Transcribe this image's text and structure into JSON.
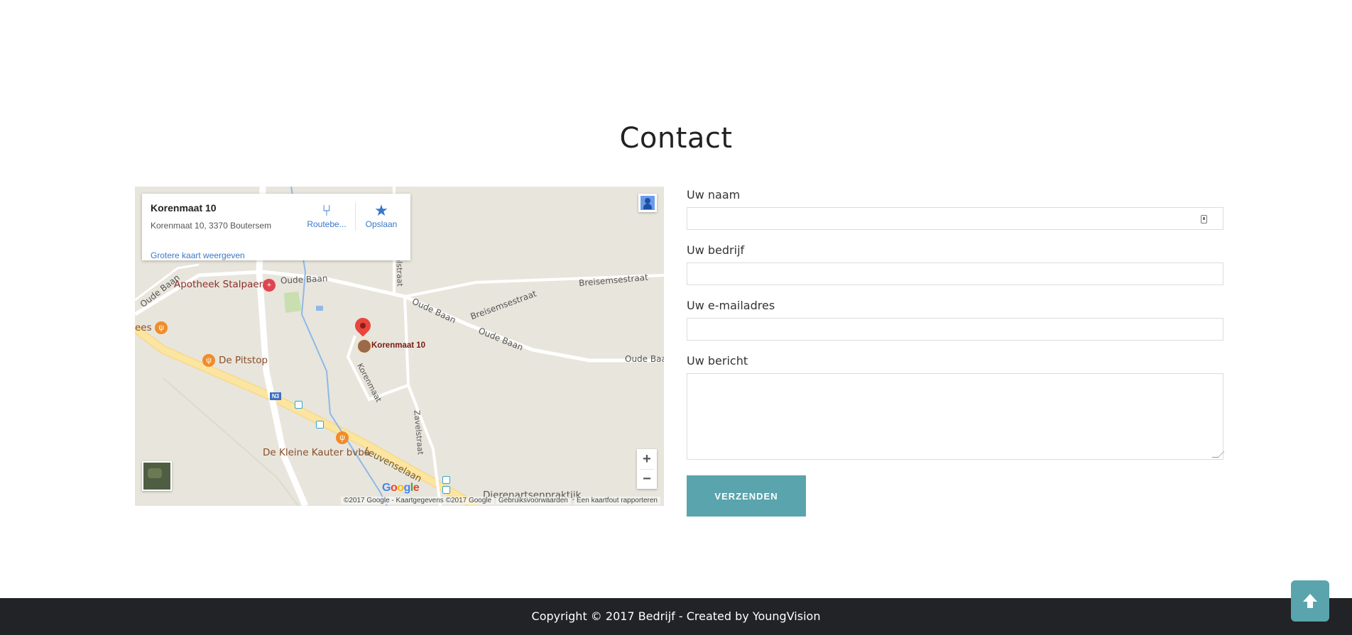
{
  "page": {
    "section_title": "Contact"
  },
  "map": {
    "info": {
      "place_name": "Korenmaat 10",
      "address": "Korenmaat 10, 3370 Boutersem",
      "larger_map_link": "Grotere kaart weergeven",
      "directions_label": "Routebe...",
      "save_label": "Opslaan"
    },
    "marker_label": "Korenmaat 10",
    "streets": {
      "oude_baan_1": "Oude Baan",
      "oude_baan_2": "Oude Baan",
      "oude_baan_3": "Oude Baan",
      "oude_baan_4": "Oude Baan",
      "oude_baan_5": "Oude Baan",
      "breisemsestraat_1": "Breisemsestraat",
      "breisemsestraat_2": "Breisemsestraat",
      "korenmaat": "Korenmaat",
      "zavelstraat": "Zavelstraat",
      "velstraat": "velstraat",
      "leuvenselaan": "Leuvenselaan",
      "n3": "N3"
    },
    "pois": {
      "apotheek": "Apotheek Stalpaert",
      "pitstop": "De Pitstop",
      "kleine_kauter": "De Kleine Kauter bvba",
      "dierenarts": "Dierenartsenpraktijk",
      "ees": "ees"
    },
    "zoom_in": "+",
    "zoom_out": "−",
    "google_logo": "Google",
    "attribution": "©2017 Google - Kaartgegevens ©2017 Google",
    "terms": "Gebruiksvoorwaarden",
    "report": "Een kaartfout rapporteren",
    "colors": {
      "land": "#e8e5dc",
      "main_road": "#fce5a0",
      "water": "#8fb8e6",
      "accent_link": "#3a78c9"
    },
    "icons": {
      "directions": "directions-icon",
      "save": "star-icon",
      "pegman": "pegman-icon",
      "marker": "map-marker-icon",
      "restaurant": "restaurant-icon",
      "pharmacy": "pharmacy-icon"
    }
  },
  "form": {
    "name_label": "Uw naam",
    "company_label": "Uw bedrijf",
    "email_label": "Uw e-mailadres",
    "message_label": "Uw bericht",
    "name_value": "",
    "company_value": "",
    "email_value": "",
    "message_value": "",
    "submit_label": "VERZENDEN",
    "button_color": "#5aa4ad"
  },
  "footer": {
    "copyright": "Copyright © 2017 Bedrijf - Created by YoungVision",
    "background": "#222326"
  },
  "back_to_top": {
    "icon": "arrow-up-icon"
  }
}
